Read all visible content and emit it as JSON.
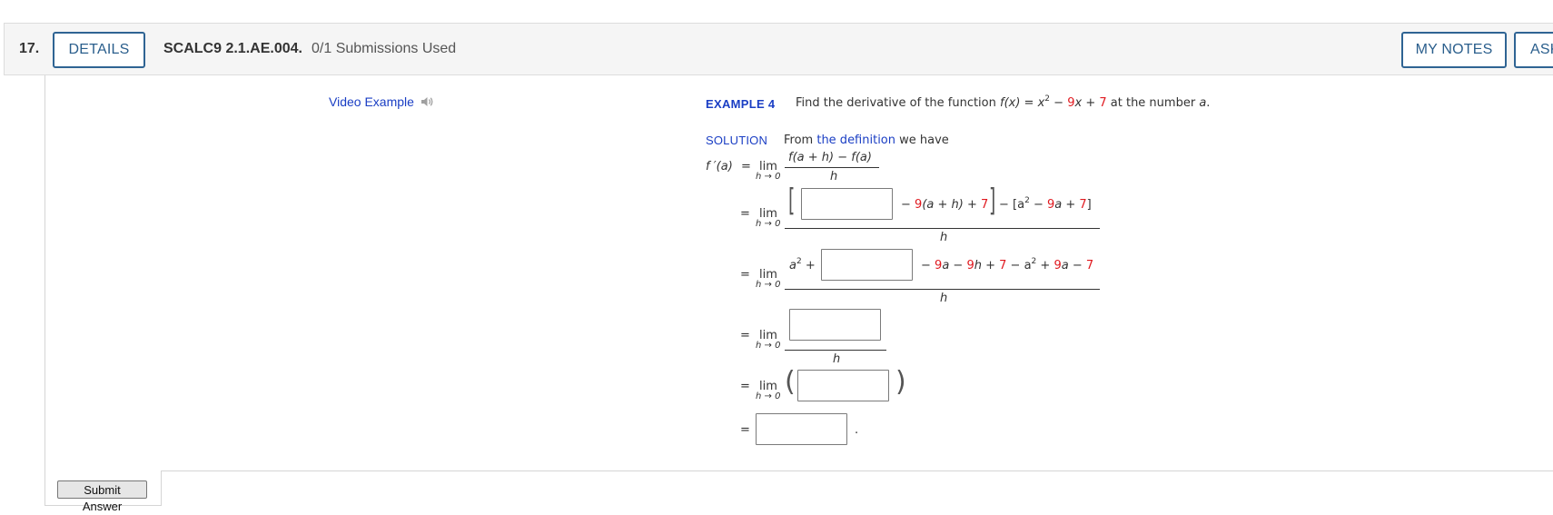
{
  "question": {
    "number": "17.",
    "details_label": "DETAILS",
    "code": "SCALC9 2.1.AE.004.",
    "submissions": "0/1 Submissions Used",
    "my_notes_label": "MY NOTES",
    "ask_label": "ASK"
  },
  "video": {
    "label": "Video Example",
    "icon": "speaker-icon"
  },
  "example": {
    "label": "EXAMPLE 4",
    "text_before": "Find the derivative of the function ",
    "fx": "f(x)",
    "eq": " = ",
    "x2": "x",
    "exp2": "2",
    "minus": " − ",
    "coef9": "9",
    "x": "x",
    "plus": " + ",
    "const7": "7",
    "text_after": " at the number ",
    "a": "a",
    "period": "."
  },
  "solution": {
    "label": "SOLUTION",
    "text_from": "From ",
    "definition_link": "the definition",
    "text_have": " we have"
  },
  "math": {
    "fprime": "f ′(a)",
    "equals": "=",
    "lim": "lim",
    "lim_sub": "h → 0",
    "def_numerator": "f(a + h) − f(a)",
    "h": "h",
    "step1": {
      "part1": "− ",
      "nine": "9",
      "part2": "(a + h) + ",
      "seven": "7",
      "part3": " − [a",
      "sq": "2",
      "part4": " − ",
      "nine_b": "9",
      "part5": "a + ",
      "seven_b": "7",
      "part6": "]"
    },
    "step2": {
      "lead": "a",
      "lead_sq": "2",
      "lead_plus": " +",
      "m1": "− ",
      "n1": "9",
      "m2": "a − ",
      "n2": "9",
      "m3": "h + ",
      "n3": "7",
      "m4": " − a",
      "sq": "2",
      "m5": " + ",
      "n4": "9",
      "m6": "a − ",
      "n5": "7"
    },
    "final_period": "."
  },
  "inputs": [
    "",
    "",
    "",
    "",
    ""
  ],
  "submit_label": "Submit Answer",
  "colors": {
    "accent": "#2f6493",
    "link": "#1a3ec4",
    "red": "#e0191f"
  }
}
